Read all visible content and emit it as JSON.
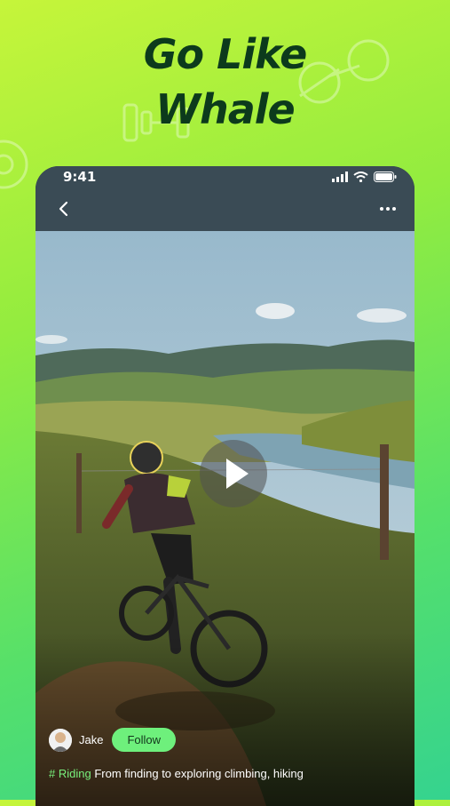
{
  "headline": {
    "line1": "Go Like",
    "line2": "Whale"
  },
  "status_bar": {
    "time": "9:41"
  },
  "post": {
    "author": "Jake",
    "follow_label": "Follow",
    "hashtag": "# Riding",
    "caption": "From finding to exploring climbing, hiking"
  },
  "colors": {
    "accent": "#6ef07c",
    "headline": "#0c3a1c",
    "background_top": "#c6f53a",
    "background_bottom": "#35d38f"
  },
  "icons": [
    "back-icon",
    "more-icon",
    "play-icon",
    "cellular-icon",
    "wifi-icon",
    "battery-icon"
  ]
}
